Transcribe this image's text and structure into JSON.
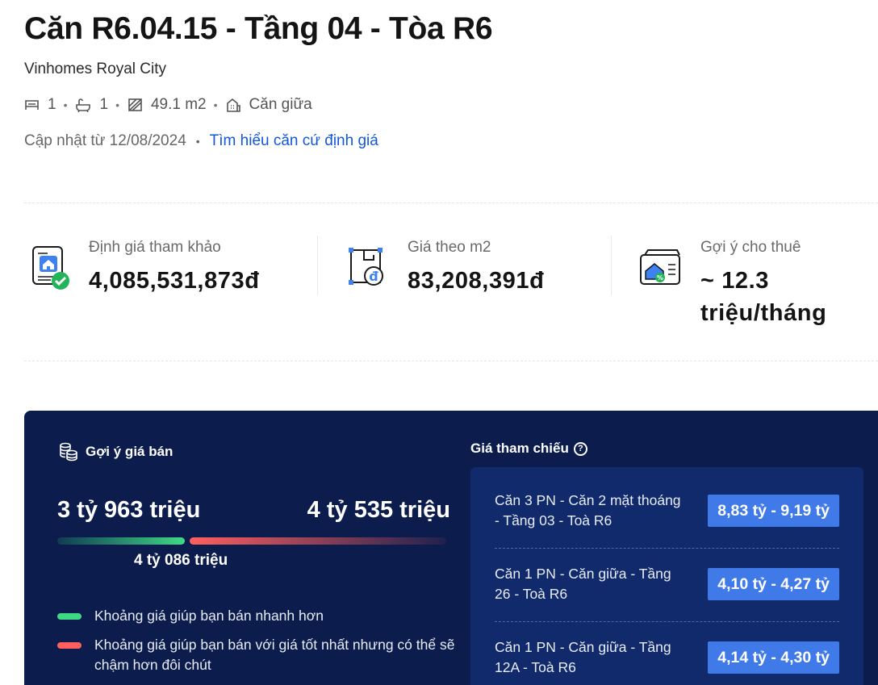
{
  "header": {
    "title": "Căn R6.04.15 - Tầng 04 - Tòa R6",
    "project": "Vinhomes Royal City",
    "bedrooms": "1",
    "bathrooms": "1",
    "area": "49.1 m2",
    "position": "Căn giữa",
    "updated": "Cập nhật từ 12/08/2024",
    "learn_link": "Tìm hiểu căn cứ định giá"
  },
  "stats": [
    {
      "label": "Định giá tham khảo",
      "value": "4,085,531,873đ",
      "icon": "house-document-check-icon"
    },
    {
      "label": "Giá theo m2",
      "value": "83,208,391đ",
      "icon": "floorplan-dong-icon"
    },
    {
      "label": "Gợi ý cho thuê",
      "value": "~ 12.3 triệu/tháng",
      "icon": "rent-house-percent-icon"
    }
  ],
  "suggest": {
    "title": "Gợi ý giá bán",
    "low": "3 tỷ 963 triệu",
    "high": "4 tỷ 535 triệu",
    "mid": "4 tỷ 086 triệu",
    "legend_fast": "Khoảng giá giúp bạn bán nhanh hơn",
    "legend_best": "Khoảng giá giúp bạn bán với giá tốt nhất nhưng có thể sẽ chậm hơn đôi chút"
  },
  "reference": {
    "title": "Giá tham chiếu",
    "items": [
      {
        "name": "Căn 3 PN - Căn 2 mặt thoáng - Tầng 03 - Toà R6",
        "price": "8,83 tỷ - 9,19 tỷ"
      },
      {
        "name": "Căn 1 PN - Căn giữa - Tầng 26 - Toà R6",
        "price": "4,10 tỷ - 4,27 tỷ"
      },
      {
        "name": "Căn 1 PN - Căn giữa - Tầng 12A - Toà R6",
        "price": "4,14 tỷ - 4,30 tỷ"
      }
    ]
  },
  "colors": {
    "panel_bg": "#0b1c4d",
    "ref_box_bg": "#112a6b",
    "price_chip": "#3f7ae8",
    "link": "#1456d8",
    "fast_green": "#3fd985",
    "best_red": "#ff5f5f"
  }
}
